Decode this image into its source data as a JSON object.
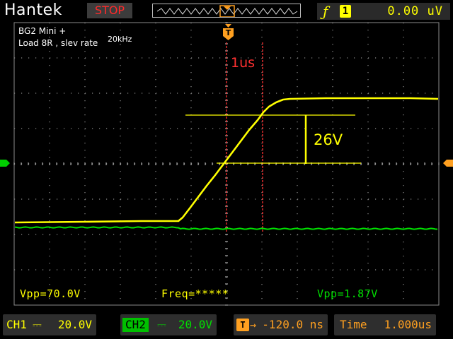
{
  "header": {
    "brand": "Hantek",
    "run_state": "STOP",
    "trigger": {
      "edge_icon": "rising-edge-icon",
      "source_channel": "1",
      "level": "0.00 uV"
    }
  },
  "annotations": {
    "line1": "BG2 Mini +",
    "line2": "Load 8R , slev rate",
    "line3": "20kHz",
    "time_mark": "1us",
    "amplitude_mark": "26V"
  },
  "markers": {
    "trigger_position": "T",
    "ch1_level_icon": "ch1-ground-marker-icon",
    "trigger_level_icon": "trigger-level-marker-icon"
  },
  "measurements": {
    "ch1_vpp": "Vpp=70.0V",
    "frequency": "Freq=*****",
    "ch2_vpp": "Vpp=1.87V"
  },
  "bottom": {
    "ch1": {
      "name": "CH1",
      "coupling": "⎓",
      "scale": "20.0V"
    },
    "ch2": {
      "name": "CH2",
      "coupling": "⎓",
      "scale": "20.0V"
    },
    "trigger_pos": {
      "icon": "T",
      "arrow": "→",
      "value": "-120.0 ns"
    },
    "timebase": {
      "label": "Time",
      "value": "1.000us"
    }
  },
  "colors": {
    "ch1": "#ffff00",
    "ch2": "#00e000",
    "annotation_red": "#ff3030",
    "grid": "#8a8a8a",
    "accent": "#ffa020"
  }
}
